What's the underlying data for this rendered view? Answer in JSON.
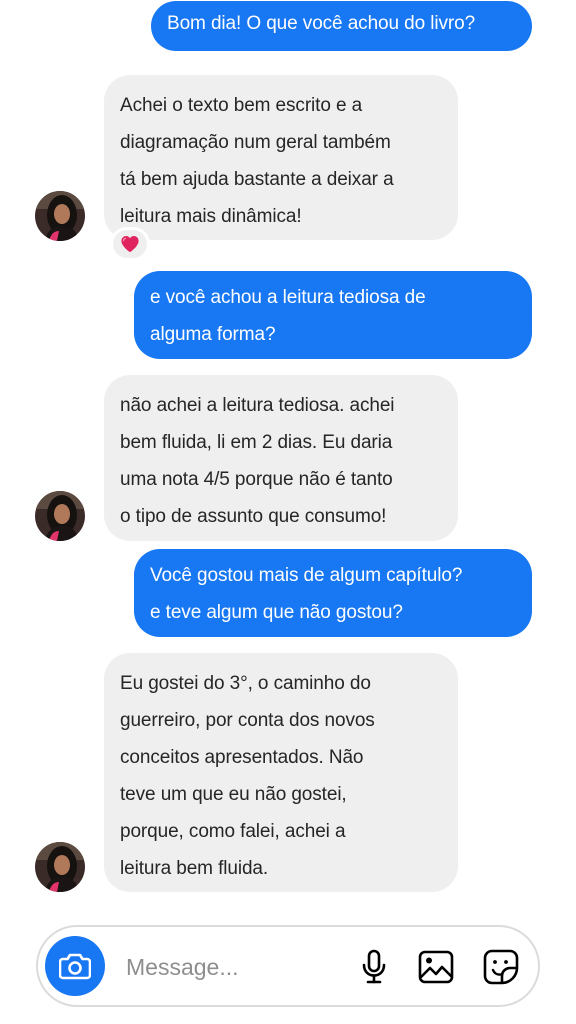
{
  "messages": [
    {
      "direction": "outgoing",
      "lines": [
        "Bom dia! O que você achou do livro?"
      ]
    },
    {
      "direction": "incoming",
      "lines": [
        "Achei o texto bem escrito e a",
        "diagramação num geral também",
        "tá bem ajuda bastante a deixar a",
        "leitura mais dinâmica!"
      ],
      "reaction": "heart"
    },
    {
      "direction": "outgoing",
      "lines": [
        "e você achou a leitura tediosa de",
        "alguma forma?"
      ]
    },
    {
      "direction": "incoming",
      "lines": [
        "não achei a leitura tediosa. achei",
        "bem fluida, li em 2 dias. Eu daria",
        "uma nota 4/5 porque não é tanto",
        "o tipo de assunto que consumo!"
      ]
    },
    {
      "direction": "outgoing",
      "lines": [
        "Você gostou mais de algum capítulo?",
        "e teve algum que não gostou?"
      ]
    },
    {
      "direction": "incoming",
      "lines": [
        "Eu gostei do 3°, o caminho do",
        "guerreiro, por conta dos novos",
        "conceitos apresentados. Não",
        "teve um que eu não gostei,",
        "porque, como falei, achei a",
        "leitura bem fluida."
      ]
    }
  ],
  "composer": {
    "placeholder": "Message...",
    "value": "",
    "icons": [
      "camera-icon",
      "microphone-icon",
      "image-icon",
      "sticker-icon"
    ]
  },
  "colors": {
    "outgoing_bubble": "#1877f2",
    "incoming_bubble": "#efefef",
    "reaction_heart": "#e0245e"
  }
}
